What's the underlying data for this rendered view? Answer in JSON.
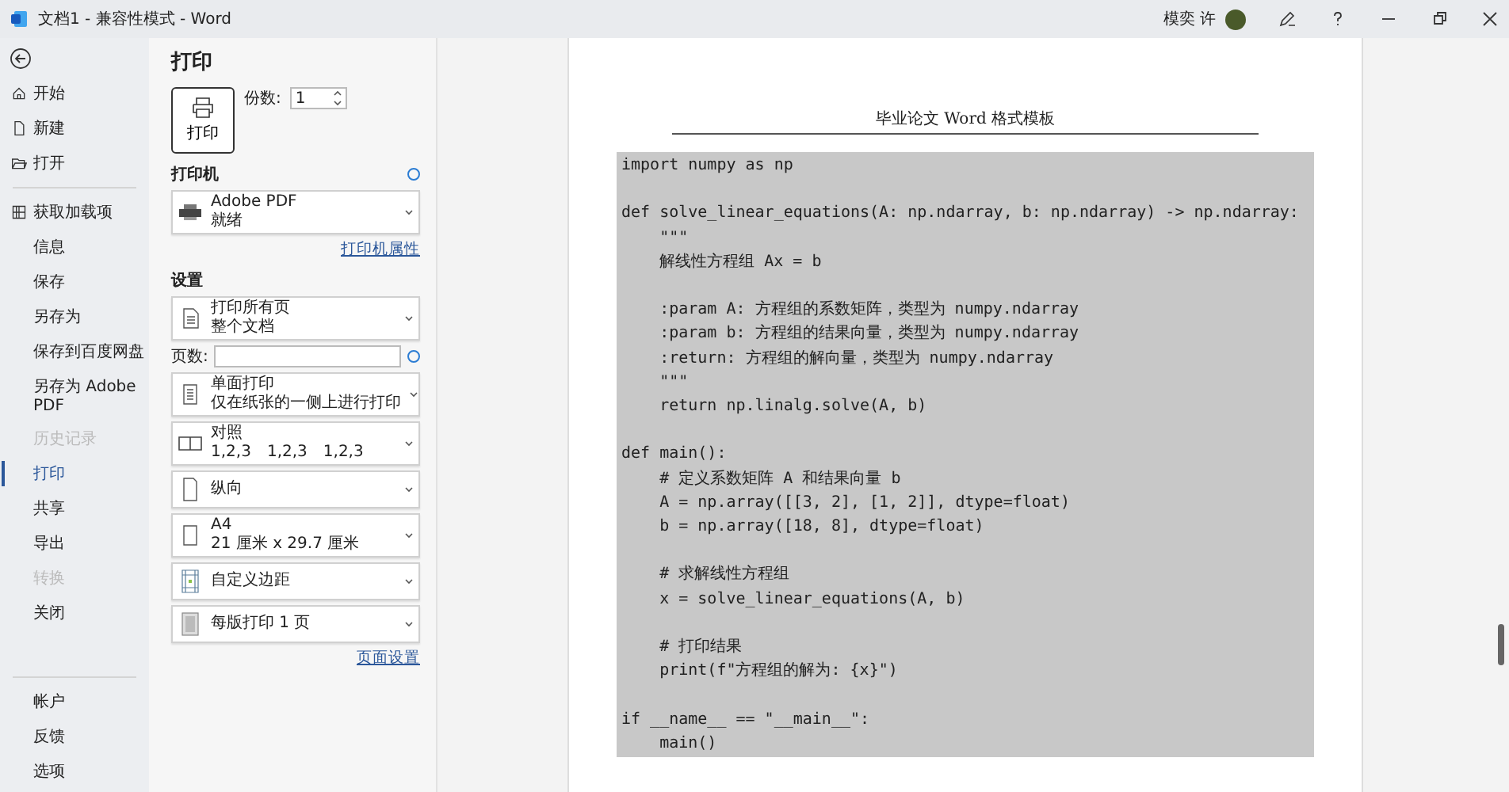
{
  "window": {
    "title": "文档1  -  兼容性模式  -  Word",
    "user": "模奕 许"
  },
  "sidebar": {
    "items": [
      {
        "label": "开始",
        "selected": false,
        "disabled": false
      },
      {
        "label": "新建",
        "selected": false,
        "disabled": false
      },
      {
        "label": "打开",
        "selected": false,
        "disabled": false
      },
      {
        "label": "获取加载项",
        "selected": false,
        "disabled": false
      },
      {
        "label": "信息",
        "selected": false,
        "disabled": false
      },
      {
        "label": "保存",
        "selected": false,
        "disabled": false
      },
      {
        "label": "另存为",
        "selected": false,
        "disabled": false
      },
      {
        "label": "保存到百度网盘",
        "selected": false,
        "disabled": false
      },
      {
        "label": "另存为 Adobe PDF",
        "selected": false,
        "disabled": false
      },
      {
        "label": "历史记录",
        "selected": false,
        "disabled": true
      },
      {
        "label": "打印",
        "selected": true,
        "disabled": false
      },
      {
        "label": "共享",
        "selected": false,
        "disabled": false
      },
      {
        "label": "导出",
        "selected": false,
        "disabled": false
      },
      {
        "label": "转换",
        "selected": false,
        "disabled": true
      },
      {
        "label": "关闭",
        "selected": false,
        "disabled": false
      }
    ],
    "bottom_items": [
      {
        "label": "帐户"
      },
      {
        "label": "反馈"
      },
      {
        "label": "选项"
      }
    ]
  },
  "print_panel": {
    "title": "打印",
    "print_button": "打印",
    "copies_label": "份数:",
    "copies": "1",
    "printer_heading": "打印机",
    "printer": {
      "name": "Adobe PDF",
      "status": "就绪"
    },
    "printer_properties": "打印机属性",
    "settings_heading": "设置",
    "settings": [
      {
        "kind": "pages",
        "label": "打印所有页",
        "detail": "整个文档"
      },
      {
        "kind": "page_range",
        "label": "页数:"
      },
      {
        "kind": "sides",
        "label": "单面打印",
        "detail": "仅在纸张的一侧上进行打印"
      },
      {
        "kind": "collate",
        "label": "对照",
        "parts": [
          "1,2,3",
          "1,2,3",
          "1,2,3"
        ]
      },
      {
        "kind": "orientation",
        "label": "纵向"
      },
      {
        "kind": "paper",
        "label": "A4",
        "detail": "21 厘米 x 29.7 厘米"
      },
      {
        "kind": "margins",
        "label": "自定义边距"
      },
      {
        "kind": "per_sheet",
        "label": "每版打印 1 页"
      }
    ],
    "page_setup": "页面设置"
  },
  "preview": {
    "header": "毕业论文 Word 格式模板",
    "code": "import numpy as np\n\ndef solve_linear_equations(A: np.ndarray, b: np.ndarray) -> np.ndarray:\n    \"\"\"\n    解线性方程组 Ax = b\n\n    :param A: 方程组的系数矩阵，类型为 numpy.ndarray\n    :param b: 方程组的结果向量，类型为 numpy.ndarray\n    :return: 方程组的解向量，类型为 numpy.ndarray\n    \"\"\"\n    return np.linalg.solve(A, b)\n\ndef main():\n    # 定义系数矩阵 A 和结果向量 b\n    A = np.array([[3, 2], [1, 2]], dtype=float)\n    b = np.array([18, 8], dtype=float)\n\n    # 求解线性方程组\n    x = solve_linear_equations(A, b)\n\n    # 打印结果\n    print(f\"方程组的解为: {x}\")\n\nif __name__ == \"__main__\":\n    main()"
  }
}
